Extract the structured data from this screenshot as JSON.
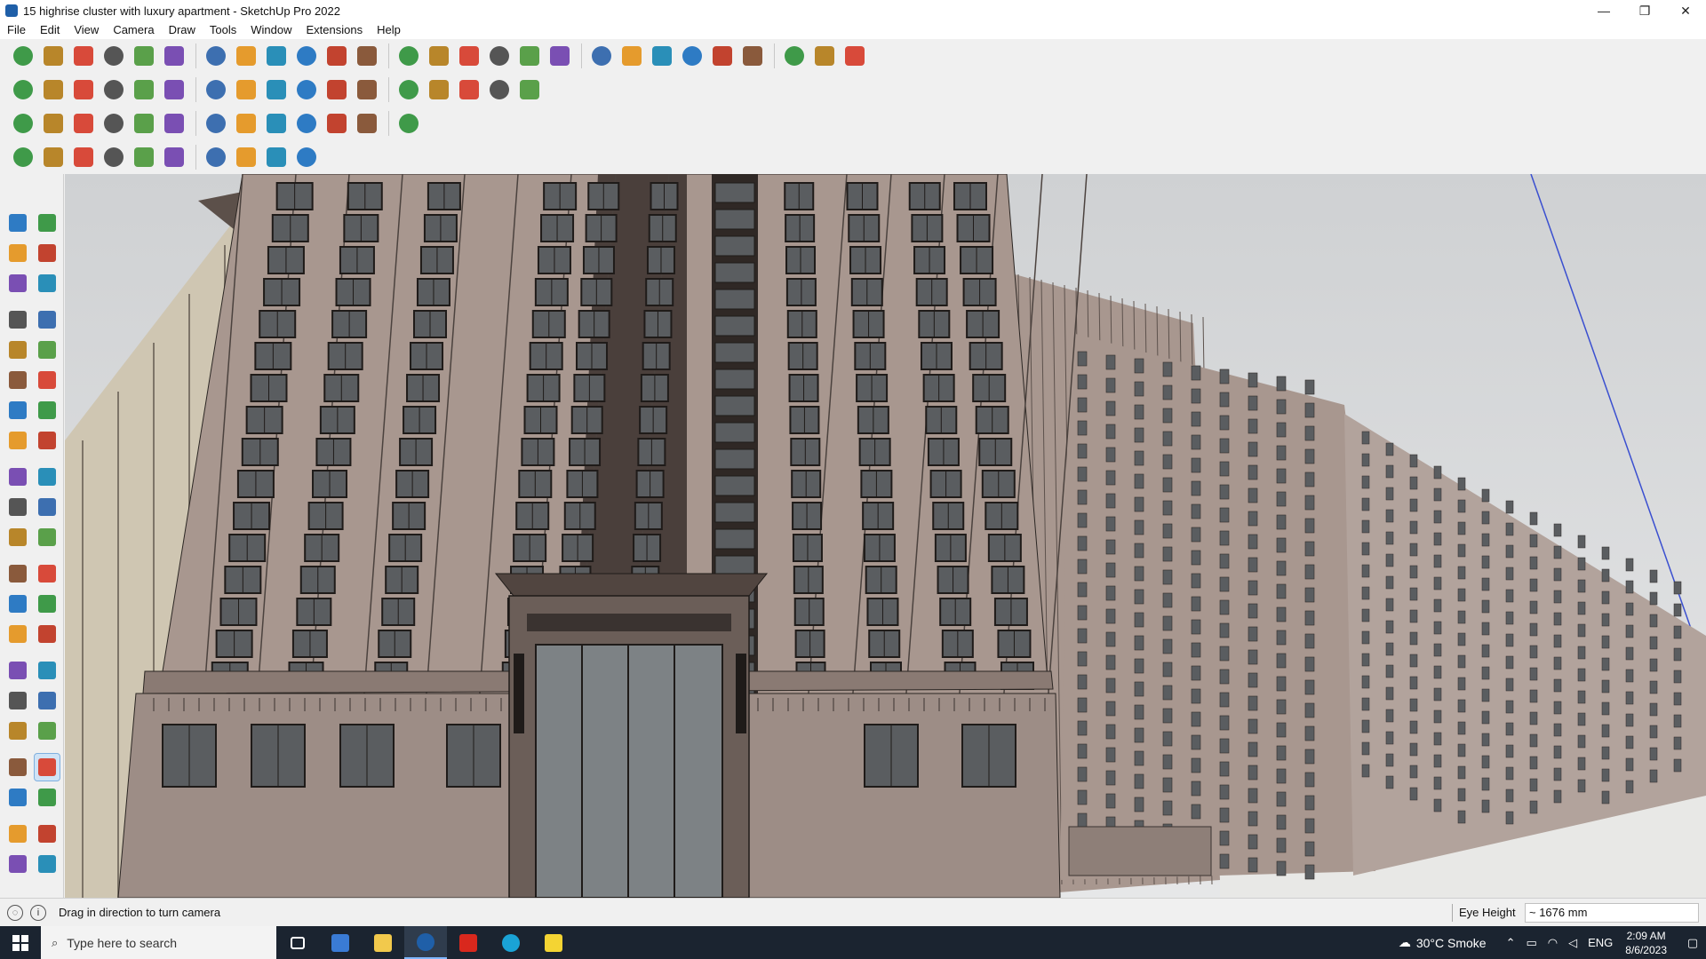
{
  "window": {
    "title": "15 highrise cluster with luxury apartment - SketchUp Pro 2022",
    "controls": {
      "minimize": "—",
      "restore": "❐",
      "close": "✕"
    }
  },
  "menu": [
    "File",
    "Edit",
    "View",
    "Camera",
    "Draw",
    "Tools",
    "Window",
    "Extensions",
    "Help"
  ],
  "toolbars": {
    "row1": [
      "zoom-extents",
      "select",
      "eraser",
      "line",
      "arc",
      "rectangle",
      "push-pull",
      "follow-me",
      "move",
      "rotate",
      "scale",
      "tape-measure",
      "text",
      "paint-bucket",
      "orbit",
      "pan",
      "zoom",
      "zoom-window",
      "component",
      "section-plane",
      "section-display",
      "layers",
      "style",
      "profile",
      "warehouse",
      "extension-warehouse",
      "export"
    ],
    "row2": [
      "iso",
      "top",
      "front",
      "right",
      "back",
      "left",
      "bottom",
      "xray",
      "back-edges",
      "wireframe",
      "hidden-line",
      "shaded",
      "textured",
      "monochrome",
      "house",
      "shadows",
      "fog"
    ],
    "row3": [
      "solid-union",
      "solid-subtract",
      "solid-trim",
      "intersect",
      "split",
      "outer-shell",
      "sandbox-from-contours",
      "sandbox-from-scratch",
      "smoove",
      "stamp",
      "drape",
      "add-detail",
      "flip-edge"
    ],
    "row4": [
      "bezier",
      "polyline",
      "fillet",
      "chamfer",
      "extrude",
      "loft",
      "sweep",
      "array",
      "offset",
      "mirror"
    ]
  },
  "palette": [
    [
      "select-icon",
      "orbit-icon"
    ],
    [
      "paint-bucket-icon",
      "eraser-icon"
    ],
    [
      "component-icon",
      "tape-icon"
    ],
    [
      "line-icon",
      "freehand-icon"
    ],
    [
      "rectangle-icon",
      "rotated-rect-icon"
    ],
    [
      "circle-icon",
      "polygon-icon"
    ],
    [
      "arc-icon",
      "arc2-icon"
    ],
    [
      "pie-icon",
      "arc3-icon"
    ],
    [
      "move-icon",
      "push-pull-icon"
    ],
    [
      "rotate-icon",
      "follow-me-icon"
    ],
    [
      "scale-icon",
      "offset-icon"
    ],
    [
      "tape-measure-icon",
      "dimension-icon"
    ],
    [
      "protractor-icon",
      "text-icon"
    ],
    [
      "axes-icon",
      "3d-text-icon"
    ],
    [
      "orbit2-icon",
      "pan-icon"
    ],
    [
      "zoom-icon",
      "zoom-window-icon"
    ],
    [
      "zoom-extents-icon",
      "previous-view-icon"
    ],
    [
      "position-camera-icon",
      "look-around-icon"
    ],
    [
      "walk-icon",
      "section-icon"
    ],
    [
      "section-plane-icon",
      "section-cut-icon"
    ],
    [
      "section-fill-icon",
      "section-display-icon"
    ]
  ],
  "status": {
    "hint": "Drag in direction to turn camera",
    "vcb_label": "Eye Height",
    "vcb_value": "~ 1676 mm"
  },
  "taskbar": {
    "search_placeholder": "Type here to search",
    "weather": "30°C  Smoke",
    "language": "ENG",
    "time": "2:09 AM",
    "date": "8/6/2023"
  },
  "colors": {
    "facade": "#a8978f",
    "facade_dark": "#6b5e58",
    "window": "#5a5d60",
    "sky": "#d9dadb"
  }
}
